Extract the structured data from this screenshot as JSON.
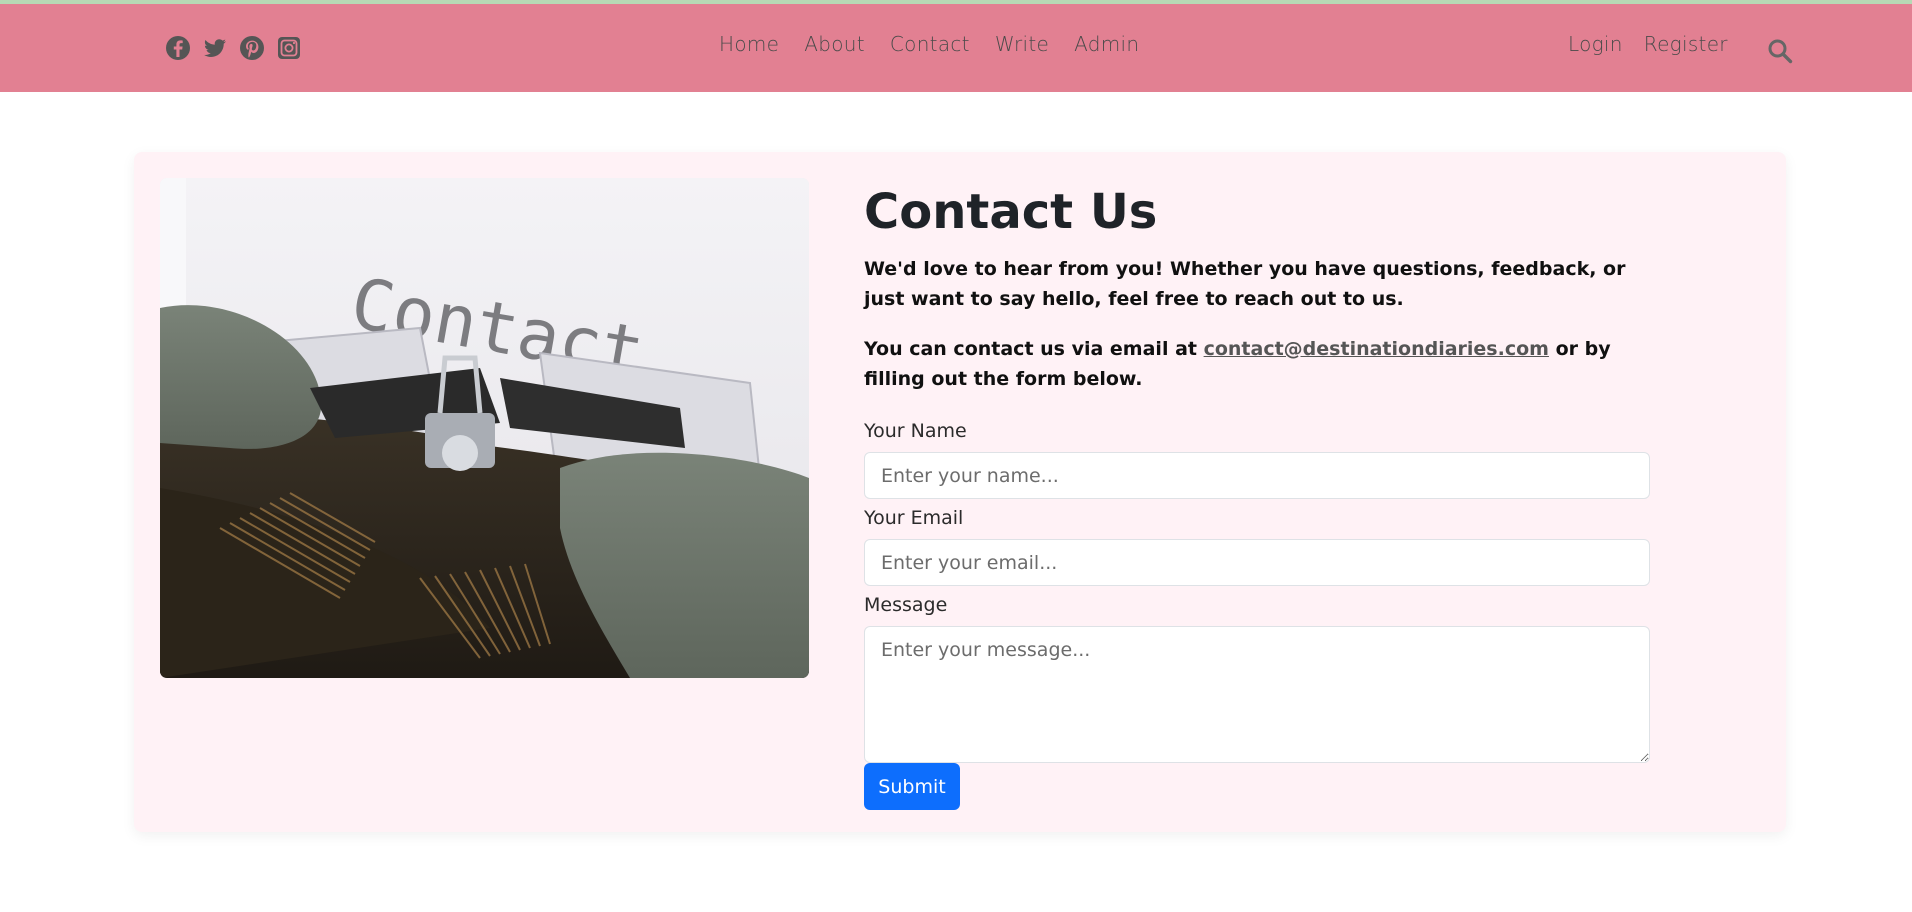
{
  "nav": {
    "social": [
      "facebook-icon",
      "twitter-icon",
      "pinterest-icon",
      "instagram-icon"
    ],
    "links": [
      "Home",
      "About",
      "Contact",
      "Write",
      "Admin"
    ],
    "auth": [
      "Login",
      "Register"
    ],
    "search_icon": "search-icon",
    "colors": {
      "navbar": "#e28092",
      "top_strip": "#b7d9b5"
    }
  },
  "photo": {
    "text": "Contact"
  },
  "contact": {
    "title": "Contact Us",
    "intro": "We'd love to hear from you! Whether you have questions, feedback, or just want to say hello, feel free to reach out to us.",
    "line2_before": "You can contact us via email at ",
    "email": "contact@destinationdiaries.com",
    "line2_after": " or by filling out the form below."
  },
  "form": {
    "name_label": "Your Name",
    "name_placeholder": "Enter your name...",
    "email_label": "Your Email",
    "email_placeholder": "Enter your email...",
    "message_label": "Message",
    "message_placeholder": "Enter your message...",
    "submit_label": "Submit",
    "colors": {
      "card_bg": "#fff2f6",
      "submit_bg": "#0d6efd"
    }
  }
}
